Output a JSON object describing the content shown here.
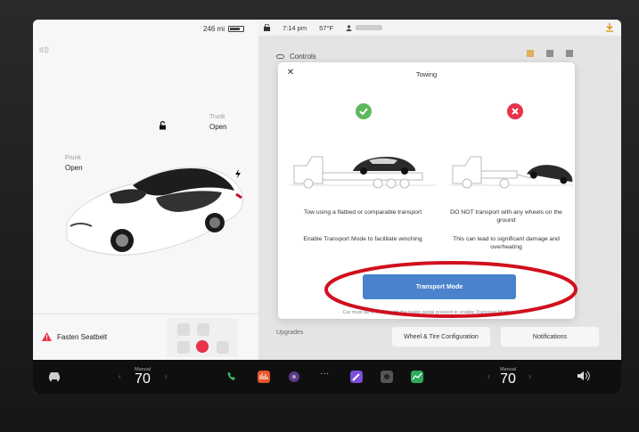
{
  "car_panel": {
    "range": "246 mi",
    "trunk_label": "Trunk",
    "trunk_value": "Open",
    "frunk_label": "Frunk",
    "frunk_value": "Open",
    "seatbelt_warning": "Fasten Seatbelt"
  },
  "status_bar": {
    "time": "7:14 pm",
    "temperature": "57°F",
    "profile_name": ""
  },
  "controls": {
    "label": "Controls",
    "profile_name": ""
  },
  "dialog": {
    "title": "Towing",
    "left_desc_1": "Tow using a flatbed or comparable transport",
    "left_desc_2": "Enable Transport Mode to facilitate winching",
    "right_desc_1": "DO NOT transport with any wheels on the ground",
    "right_desc_2": "This can lead to significant damage and overheating",
    "button_label": "Transport Mode",
    "hint": "Car must be in PARK with the brake pedal pressed to enable Transport Mode"
  },
  "background_menu": {
    "item": "Upgrades",
    "button_1": "Wheel & Tire Configuration",
    "button_2": "Notifications"
  },
  "bottom_bar": {
    "driver_temp_label": "Manual",
    "driver_temp": "70",
    "passenger_temp_label": "Manual",
    "passenger_temp": "70"
  },
  "colors": {
    "accent_blue": "#4a82cc",
    "ok_green": "#5cb85c",
    "no_red": "#e8334a",
    "annotation_red": "#d0101e"
  },
  "icons": [
    "headlight-icon",
    "lock-icon",
    "charge-icon",
    "warning-icon",
    "profile-icon",
    "download-icon",
    "toggle-icon",
    "check-icon",
    "cross-icon",
    "car-icon",
    "phone-icon",
    "music-icon",
    "camera-icon",
    "energy-icon",
    "volume-icon"
  ]
}
